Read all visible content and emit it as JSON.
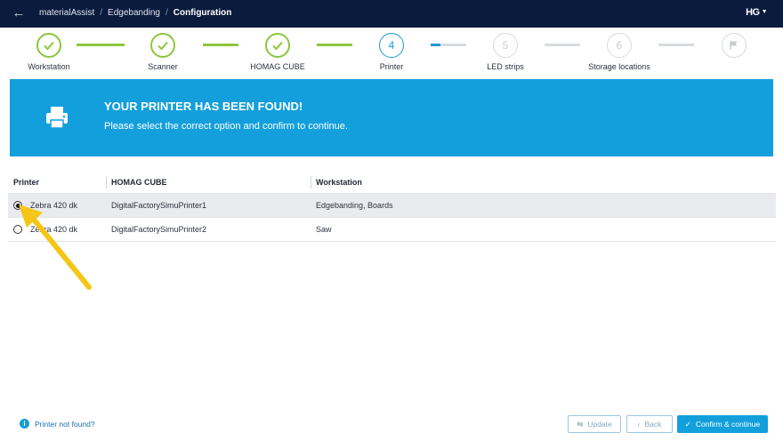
{
  "topbar": {
    "breadcrumbs": [
      "materialAssist",
      "Edgebanding",
      "Configuration"
    ],
    "logo": "HG"
  },
  "stepper": {
    "steps": [
      {
        "label": "Workstation",
        "state": "done",
        "number": ""
      },
      {
        "label": "Scanner",
        "state": "done",
        "number": ""
      },
      {
        "label": "HOMAG CUBE",
        "state": "done",
        "number": ""
      },
      {
        "label": "Printer",
        "state": "active",
        "number": "4"
      },
      {
        "label": "LED strips",
        "state": "todo",
        "number": "5"
      },
      {
        "label": "Storage locations",
        "state": "todo",
        "number": "6"
      },
      {
        "label": "",
        "state": "todo",
        "number": ""
      }
    ]
  },
  "banner": {
    "title": "YOUR PRINTER HAS BEEN FOUND!",
    "subtitle": "Please select the correct option and confirm to continue."
  },
  "table": {
    "headers": [
      "Printer",
      "HOMAG CUBE",
      "Workstation"
    ],
    "rows": [
      {
        "printer": "Zebra 420 dk",
        "cube": "DigitalFactorySimuPrinter1",
        "workstation": "Edgebanding, Boards",
        "selected": true
      },
      {
        "printer": "Zebra 420 dk",
        "cube": "DigitalFactorySimuPrinter2",
        "workstation": "Saw",
        "selected": false
      }
    ]
  },
  "footer": {
    "not_found_label": "Printer not found?",
    "update_label": "Update",
    "back_label": "Back",
    "confirm_label": "Confirm & continue"
  },
  "colors": {
    "header_bg": "#0a1b3d",
    "accent": "#139fdc",
    "done": "#8cc63f",
    "annotation_arrow": "#f5c518"
  }
}
